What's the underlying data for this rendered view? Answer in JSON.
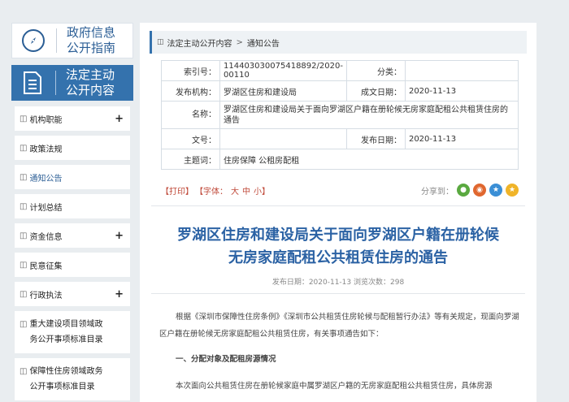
{
  "sidebar": {
    "top_label_line1": "政府信息",
    "top_label_line2": "公开指南",
    "active_label_line1": "法定主动",
    "active_label_line2": "公开内容",
    "items": [
      {
        "label": "机构职能",
        "plus": "+"
      },
      {
        "label": "政策法规",
        "plus": ""
      },
      {
        "label": "通知公告",
        "plus": ""
      },
      {
        "label": "计划总结",
        "plus": ""
      },
      {
        "label": "资金信息",
        "plus": "+"
      },
      {
        "label": "民意征集",
        "plus": ""
      },
      {
        "label": "行政执法",
        "plus": "+"
      },
      {
        "label_line1": "重大建设项目领域政",
        "label_line2": "务公开事项标准目录"
      },
      {
        "label_line1": "保障性住房领域政务",
        "label_line2": "公开事项标准目录"
      }
    ]
  },
  "breadcrumb": {
    "item1": "法定主动公开内容",
    "separator": ">",
    "item2": "通知公告"
  },
  "meta": {
    "index_label": "索引号：",
    "index_value": "114403030075418892/2020-00110",
    "category_label": "分类：",
    "category_value": "",
    "publisher_label": "发布机构：",
    "publisher_value": "罗湖区住房和建设局",
    "created_label": "成文日期：",
    "created_value": "2020-11-13",
    "name_label": "名称：",
    "name_value": "罗湖区住房和建设局关于面向罗湖区户籍在册轮候无房家庭配租公共租赁住房的通告",
    "docno_label": "文号：",
    "docno_value": "",
    "pubdate_label": "发布日期：",
    "pubdate_value": "2020-11-13",
    "topic_label": "主题词：",
    "topic_value": "住房保障 公租房配租"
  },
  "toolbar": {
    "print": "【打印】",
    "font_label": "【字体：",
    "font_large": "大",
    "font_medium": "中",
    "font_small": "小】",
    "share_label": "分享到："
  },
  "article": {
    "title_line1": "罗湖区住房和建设局关于面向罗湖区户籍在册轮候",
    "title_line2": "无房家庭配租公共租赁住房的通告",
    "pubinfo": "发布日期：2020-11-13   浏览次数：298",
    "para1": "根据《深圳市保障性住房条例》《深圳市公共租赁住房轮候与配租暂行办法》等有关规定，现面向罗湖区户籍在册轮候无房家庭配租公共租赁住房，有关事项通告如下：",
    "heading1": "一、分配对象及配租房源情况",
    "para2": "本次面向公共租赁住房在册轮候家庭中属罗湖区户籍的无房家庭配租公共租赁住房，具体房源"
  },
  "colors": {
    "accent": "#3472ad",
    "title": "#2b62a4",
    "toolbar_red": "#c04a3a"
  }
}
